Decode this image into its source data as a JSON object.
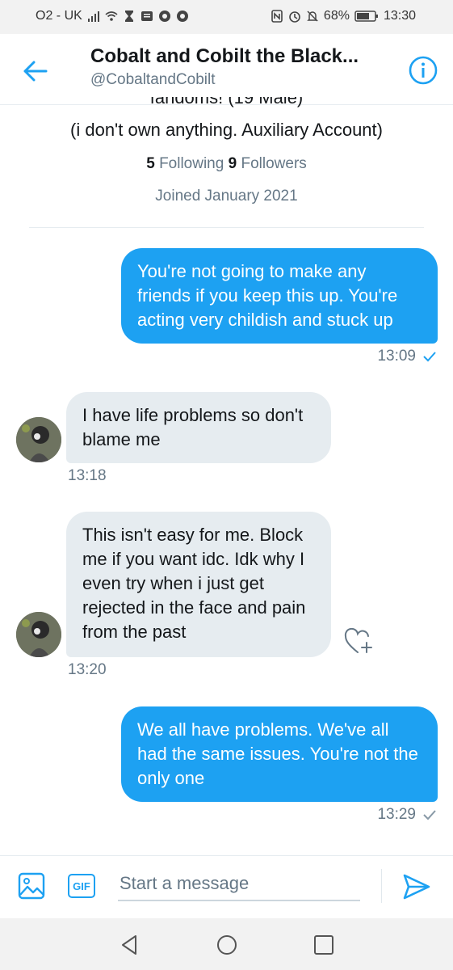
{
  "status_bar": {
    "carrier": "O2 - UK",
    "battery": "68%",
    "time": "13:30"
  },
  "header": {
    "back_icon": "arrow-left-icon",
    "name": "Cobalt and Cobilt the Black...",
    "handle": "@CobaltandCobilt",
    "info_icon": "info-icon"
  },
  "profile": {
    "bio_cut": "fandoms! (19 Male)",
    "bio": "(i don't own anything. Auxiliary Account)",
    "following_count": "5",
    "following_label": "Following",
    "followers_count": "9",
    "followers_label": "Followers",
    "joined": "Joined January 2021"
  },
  "messages": [
    {
      "type": "sent",
      "text": "You're not going to make any friends if you keep this up. You're acting very childish and stuck up",
      "time": "13:09"
    },
    {
      "type": "received",
      "text": "I have life problems so don't blame me",
      "time": "13:18"
    },
    {
      "type": "received",
      "text": "This isn't easy for me. Block me if you want idc. Idk why I even try when i just get rejected in the face and pain from the past",
      "time": "13:20"
    },
    {
      "type": "sent",
      "text": "We all have problems.  We've all had the same issues. You're not the only one",
      "time": "13:29"
    }
  ],
  "composer": {
    "gif_label": "GIF",
    "placeholder": "Start a message"
  },
  "colors": {
    "accent": "#1da1f2",
    "received_bubble": "#e6ecf0",
    "muted_text": "#657786"
  }
}
